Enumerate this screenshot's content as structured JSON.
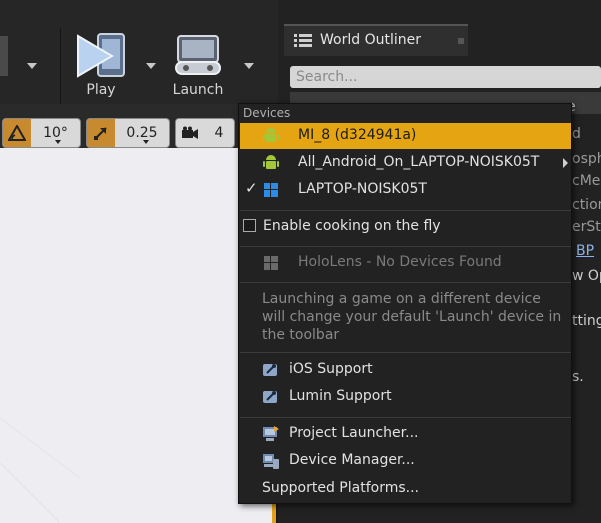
{
  "toolbar": {
    "play_label": "Play",
    "launch_label": "Launch"
  },
  "viewport": {
    "rotation_snap": "10°",
    "scale_snap": "0.25",
    "camera_speed": "4"
  },
  "world_outliner": {
    "tab_title": "World Outliner",
    "search_placeholder": "Search...",
    "column_header_fragment": "e",
    "partial_rows": [
      "d",
      "osph",
      "cMe",
      "ction",
      "erSta",
      "BP",
      "w Opt",
      "ttings",
      "s."
    ]
  },
  "launch_menu": {
    "section_header": "Devices",
    "devices": [
      {
        "label": "MI_8 (d324941a)",
        "icon": "android-icon",
        "highlighted": true,
        "checked": false,
        "has_submenu": false
      },
      {
        "label": "All_Android_On_LAPTOP-NOISK05T",
        "icon": "android-icon",
        "highlighted": false,
        "checked": false,
        "has_submenu": true
      },
      {
        "label": "LAPTOP-NOISK05T",
        "icon": "windows-icon",
        "highlighted": false,
        "checked": true,
        "has_submenu": false
      }
    ],
    "enable_cooking_label": "Enable cooking on the fly",
    "enable_cooking_checked": false,
    "hololens_label": "HoloLens - No Devices Found",
    "note": "Launching a game on a different device will change your default 'Launch' device in the toolbar",
    "ios_support": "iOS Support",
    "lumin_support": "Lumin Support",
    "project_launcher": "Project Launcher...",
    "device_manager": "Device Manager...",
    "supported_platforms": "Supported Platforms..."
  },
  "colors": {
    "highlight": "#e5a513",
    "viewport_border": "#e4a21a",
    "android_green": "#a4c639",
    "windows_blue": "#2b8be6"
  }
}
